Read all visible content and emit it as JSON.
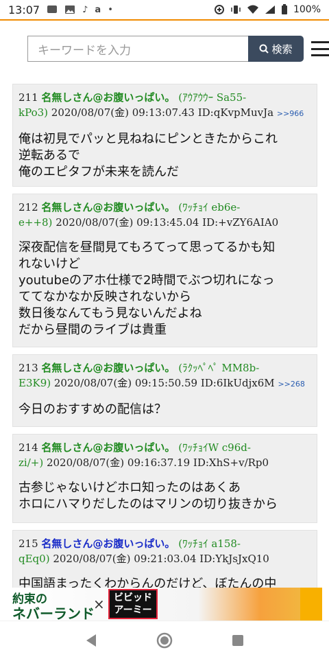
{
  "status_bar": {
    "time": "13:07",
    "battery": "100%"
  },
  "search": {
    "placeholder": "キーワードを入力",
    "button_label": "検索"
  },
  "posts": [
    {
      "number": "211",
      "name": "名無しさん@お腹いっぱい。",
      "trip_line1": "(ｱｳｱｳｳｰ Sa55-",
      "trip_line2": "kPo3)",
      "date": "2020/08/07(金) 09:13:07.43",
      "id": "ID:qKvpMuvJa",
      "reply": ">>966",
      "body": [
        "俺は初見でパッと見ねねにピンときたからこれ",
        "逆転あるで",
        "俺のエピタフが未来を読んだ"
      ]
    },
    {
      "number": "212",
      "name": "名無しさん@お腹いっぱい。",
      "trip_line1": "(ﾜｯﾁｮｲ eb6e-",
      "trip_line2": "e++8)",
      "date": "2020/08/07(金) 09:13:45.04",
      "id": "ID:+vZY6AIA0",
      "reply": "",
      "body": [
        "深夜配信を昼間見てもろてって思ってるかも知",
        "れないけど",
        "youtubeのアホ仕様で2時間でぶつ切れになっ",
        "ててなかなか反映されないから",
        "数日後なんてもう見ないんだよね",
        "だから昼間のライブは貴重"
      ]
    },
    {
      "number": "213",
      "name": "名無しさん@お腹いっぱい。",
      "trip_line1": "(ﾗｸｯﾍﾟﾍﾟ MM8b-",
      "trip_line2": "E3K9)",
      "date": "2020/08/07(金) 09:15:50.59",
      "id": "ID:6IkUdjx6M",
      "reply": ">>268",
      "body": [
        "今日のおすすめの配信は？"
      ]
    },
    {
      "number": "214",
      "name": "名無しさん@お腹いっぱい。",
      "trip_line1": "(ﾜｯﾁｮｲW c96d-",
      "trip_line2": "zi/+)",
      "date": "2020/08/07(金) 09:16:37.19",
      "id": "ID:XhS+v/Rp0",
      "reply": "",
      "body": [
        "古参じゃないけどホロ知ったのはあくあ",
        "ホロにハマりだしたのはマリンの切り抜きから"
      ]
    },
    {
      "number": "215",
      "name": "名無しさん@お腹いっぱい。",
      "trip_line1": "(ﾜｯﾁｮｲ a158-",
      "trip_line2": "qEq0)",
      "date": "2020/08/07(金) 09:21:03.04",
      "id": "ID:YkJsJxQ10",
      "reply": "",
      "body": [
        "中国語まったくわからんのだけど、ぼたんの中"
      ]
    }
  ],
  "ad": {
    "line1": "約束の",
    "line2": "ネバーランド",
    "times": "×",
    "vivid_line1": "ビビッド",
    "vivid_line2": "アーミー"
  },
  "colors": {
    "accent": "#f08a00",
    "name_green": "#228b22",
    "name_blue": "#1a2cc8",
    "search_button": "#3b4a5e"
  }
}
